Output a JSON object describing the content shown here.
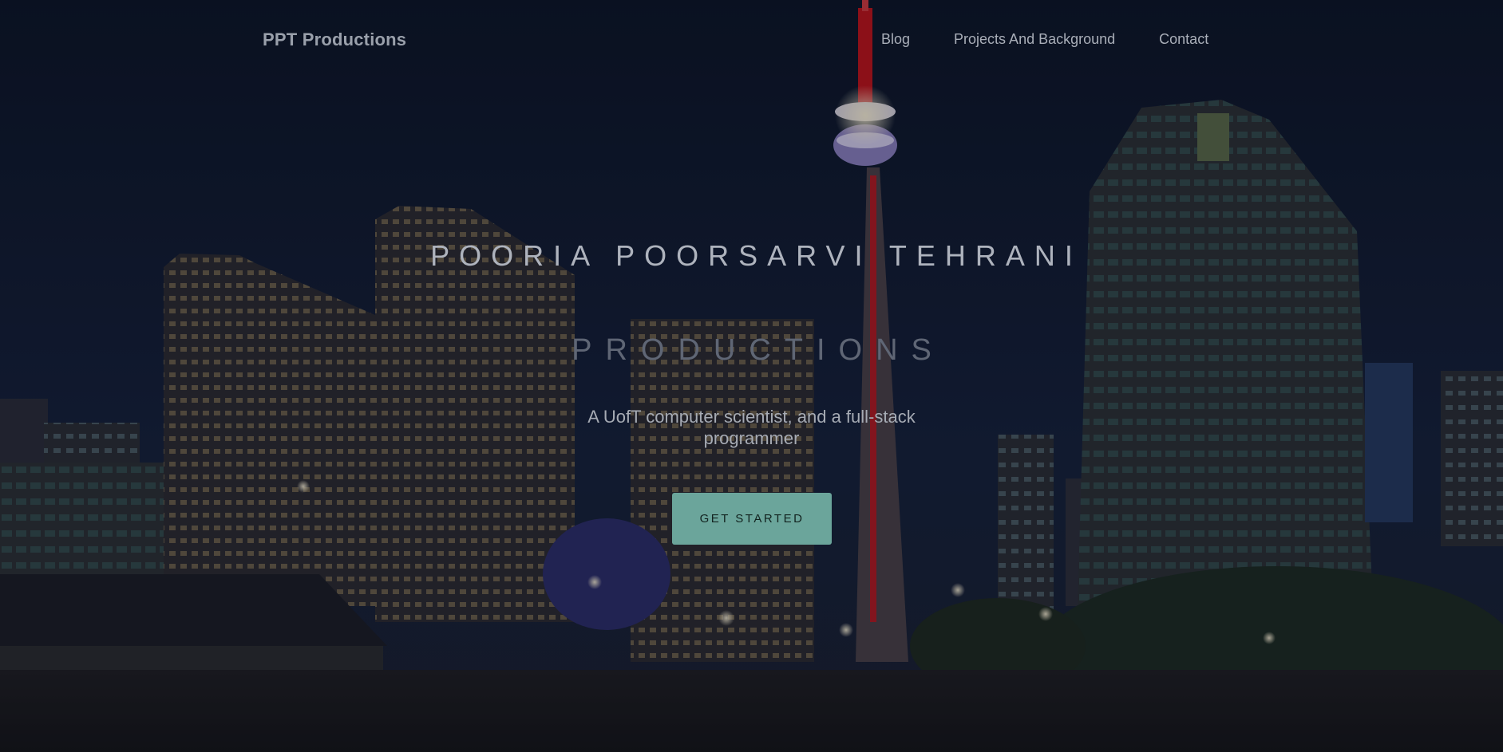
{
  "navbar": {
    "brand": "PPT Productions",
    "links": [
      {
        "label": "Blog"
      },
      {
        "label": "Projects And Background"
      },
      {
        "label": "Contact"
      }
    ]
  },
  "hero": {
    "title": "POORIA POORSARVI TEHRANI",
    "subtitle": "PRODUCTIONS",
    "tagline": "A UofT computer scientist, and a full-stack programmer",
    "cta_label": "GET STARTED",
    "background_image": "toronto-skyline-night-cn-tower"
  },
  "colors": {
    "cta_background": "#6ba59b",
    "overlay": "#0e1526",
    "tower_red": "#c0121a"
  }
}
